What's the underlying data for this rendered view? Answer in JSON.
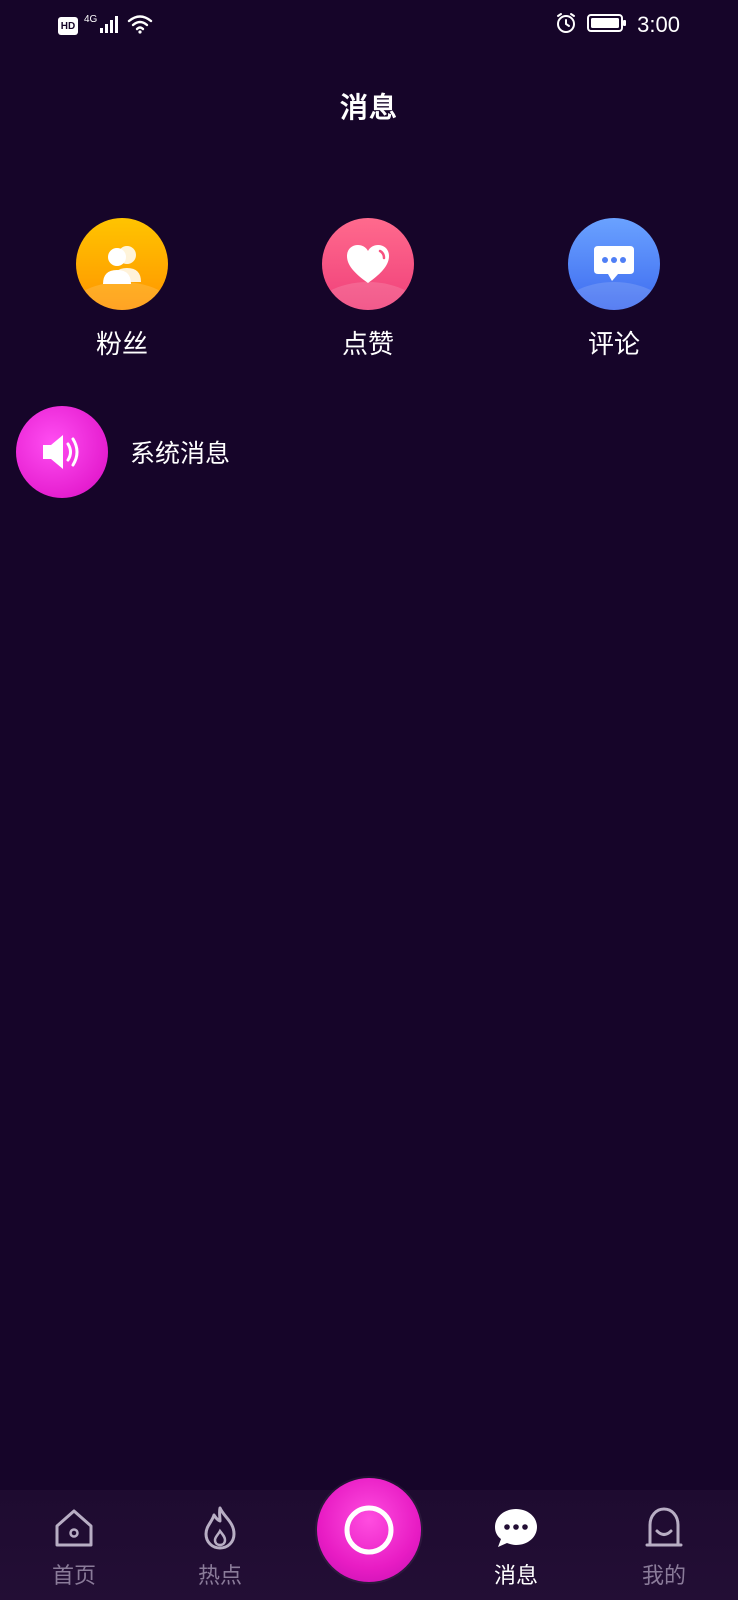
{
  "status_bar": {
    "hd": "HD",
    "network": "4G",
    "time": "3:00",
    "icons": [
      "hd-icon",
      "signal-icon",
      "wifi-icon",
      "alarm-icon",
      "battery-icon"
    ]
  },
  "header": {
    "title": "消息"
  },
  "categories": [
    {
      "label": "粉丝",
      "icon": "fans-icon",
      "color": "#ffb300"
    },
    {
      "label": "点赞",
      "icon": "heart-icon",
      "color": "#f7517f"
    },
    {
      "label": "评论",
      "icon": "comment-icon",
      "color": "#4f7ff5"
    }
  ],
  "system_message": {
    "label": "系统消息",
    "icon": "speaker-icon",
    "color": "#ef2ad9"
  },
  "bottom_nav": {
    "items": [
      {
        "label": "首页",
        "icon": "home-icon"
      },
      {
        "label": "热点",
        "icon": "flame-icon"
      },
      {
        "label": "",
        "icon": "record-icon"
      },
      {
        "label": "消息",
        "icon": "message-icon",
        "active": true
      },
      {
        "label": "我的",
        "icon": "profile-icon"
      }
    ],
    "accent": "#e81cc4"
  },
  "colors": {
    "background": "#160529",
    "nav_inactive": "#8a7b99"
  }
}
